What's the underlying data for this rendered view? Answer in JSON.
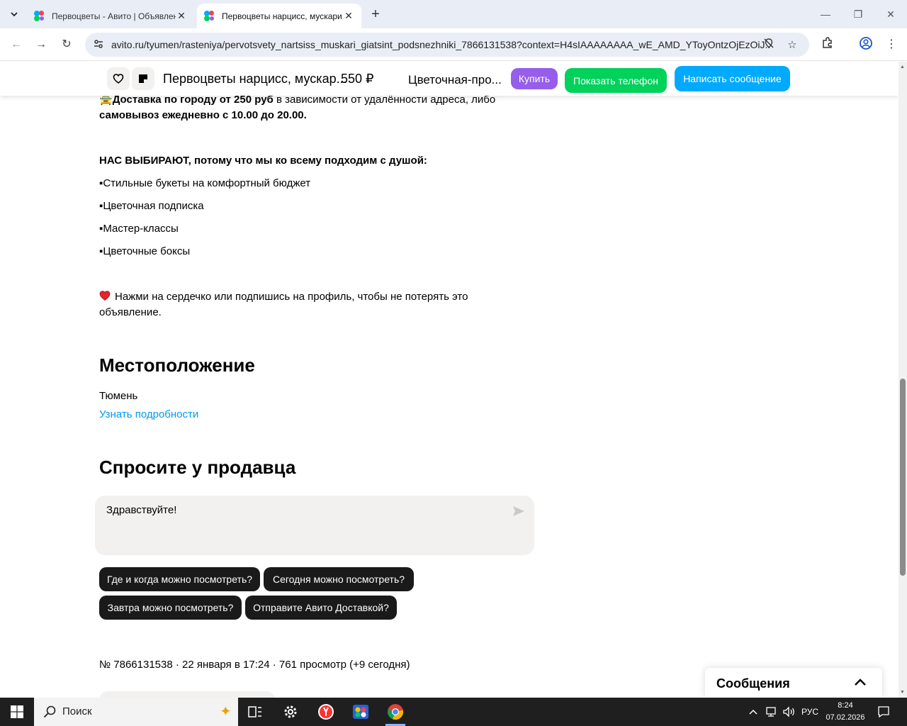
{
  "browser": {
    "tabs": [
      {
        "title": "Первоцветы - Авито | Объявления"
      },
      {
        "title": "Первоцветы нарцисс, мускари, гиацинт"
      }
    ],
    "url": "avito.ru/tyumen/rasteniya/pervotsvety_nartsiss_muskari_giatsint_podsnezhniki_7866131538?context=H4sIAAAAAAAA_wE_AMD_YToyOntzOjEzOiJ..."
  },
  "sticky_header": {
    "title": "Первоцветы нарцисс, мускар...",
    "price": "550 ₽",
    "seller": "Цветочная-про...",
    "buy_label": "Купить",
    "phone_label": "Показать телефон",
    "message_label": "Написать сообщение"
  },
  "description": {
    "delivery_emoji": "🚖",
    "delivery_bold": "Доставка по городу от 250 руб",
    "delivery_rest": " в зависимости от удалённости адреса, либо",
    "pickup": "самовывоз ежедневно с 10.00 до 20.00.",
    "choose_heading": "НАС ВЫБИРАЮТ, потому что мы ко всему подходим с душой:",
    "bullets": [
      "▪Стильные букеты на комфортный бюджет",
      "▪Цветочная подписка",
      "▪Мастер-классы",
      "▪Цветочные боксы"
    ],
    "heart_line1": "Нажми на сердечко или подпишись на профиль, чтобы не потерять это",
    "heart_line2": "объявление."
  },
  "location": {
    "heading": "Местоположение",
    "city": "Тюмень",
    "details_link": "Узнать подробности"
  },
  "ask": {
    "heading": "Спросите у продавца",
    "input_value": "Здравствуйте!",
    "chips": [
      "Где и когда можно посмотреть?",
      "Сегодня можно посмотреть?",
      "Завтра можно посмотреть?",
      "Отправите Авито Доставкой?"
    ]
  },
  "ad_meta": "№ 7866131538 · 22 января в 17:24 · 761 просмотр (+9 сегодня)",
  "messenger": {
    "title": "Сообщения"
  },
  "taskbar": {
    "search_label": "Поиск",
    "language": "РУС",
    "time": "8:24",
    "date": "07.02.2026"
  },
  "colors": {
    "buy": "#965eeb",
    "phone": "#02d15c",
    "message": "#00aaff",
    "link": "#0099f7"
  }
}
